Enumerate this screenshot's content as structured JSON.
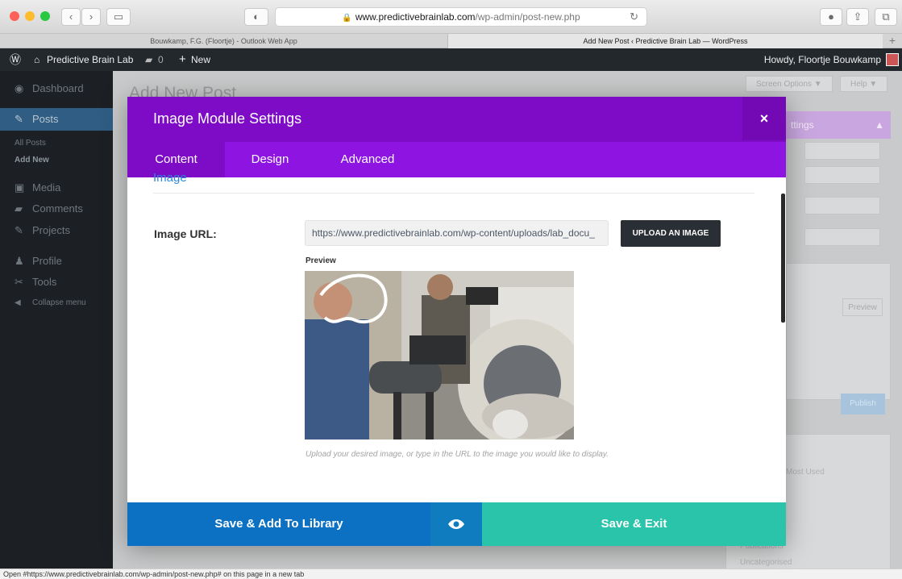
{
  "browser": {
    "url_host": "www.predictivebrainlab.com",
    "url_path": "/wp-admin/post-new.php",
    "tabs": [
      {
        "title": "Bouwkamp, F.G. (Floortje) - Outlook Web App",
        "active": false
      },
      {
        "title": "Add New Post ‹ Predictive Brain Lab — WordPress",
        "active": true
      }
    ],
    "status_text": "Open #https://www.predictivebrainlab.com/wp-admin/post-new.php# on this page in a new tab"
  },
  "adminbar": {
    "site_name": "Predictive Brain Lab",
    "comments_count": "0",
    "new_label": "New",
    "greeting": "Howdy, Floortje Bouwkamp"
  },
  "sidebar": {
    "items": [
      {
        "label": "Dashboard",
        "icon": "dashboard-icon"
      },
      {
        "label": "Posts",
        "icon": "pin-icon"
      },
      {
        "label": "Media",
        "icon": "media-icon"
      },
      {
        "label": "Comments",
        "icon": "comment-icon"
      },
      {
        "label": "Projects",
        "icon": "pin-icon"
      },
      {
        "label": "Profile",
        "icon": "profile-icon"
      },
      {
        "label": "Tools",
        "icon": "tools-icon"
      },
      {
        "label": "Collapse menu",
        "icon": "collapse-icon"
      }
    ],
    "sub_items": [
      "All Posts",
      "Add New"
    ]
  },
  "background": {
    "page_title": "Add New Post",
    "screen_options": "Screen Options ▼",
    "help": "Help ▼",
    "settings_tab": "ttings",
    "preview_btn": "Preview",
    "publish_btn": "Publish",
    "most_used": "Most Used",
    "publications": "Publications",
    "uncategorised": "Uncategorised"
  },
  "modal": {
    "title": "Image Module Settings",
    "tabs": [
      "Content",
      "Design",
      "Advanced"
    ],
    "active_tab": "Content",
    "field_label": "Image URL:",
    "image_url_value": "https://www.predictivebrainlab.com/wp-content/uploads/lab_docu_",
    "upload_button": "UPLOAD AN IMAGE",
    "preview_label": "Preview",
    "help_text": "Upload your desired image, or type in the URL to the image you would like to display.",
    "save_library_button": "Save & Add To Library",
    "save_exit_button": "Save & Exit"
  },
  "colors": {
    "modal_header": "#7e0cc7",
    "modal_tabs": "#8e14e1",
    "save_library": "#0c71c3",
    "save_exit": "#29c4a9",
    "wp_adminbar": "#23282d"
  }
}
